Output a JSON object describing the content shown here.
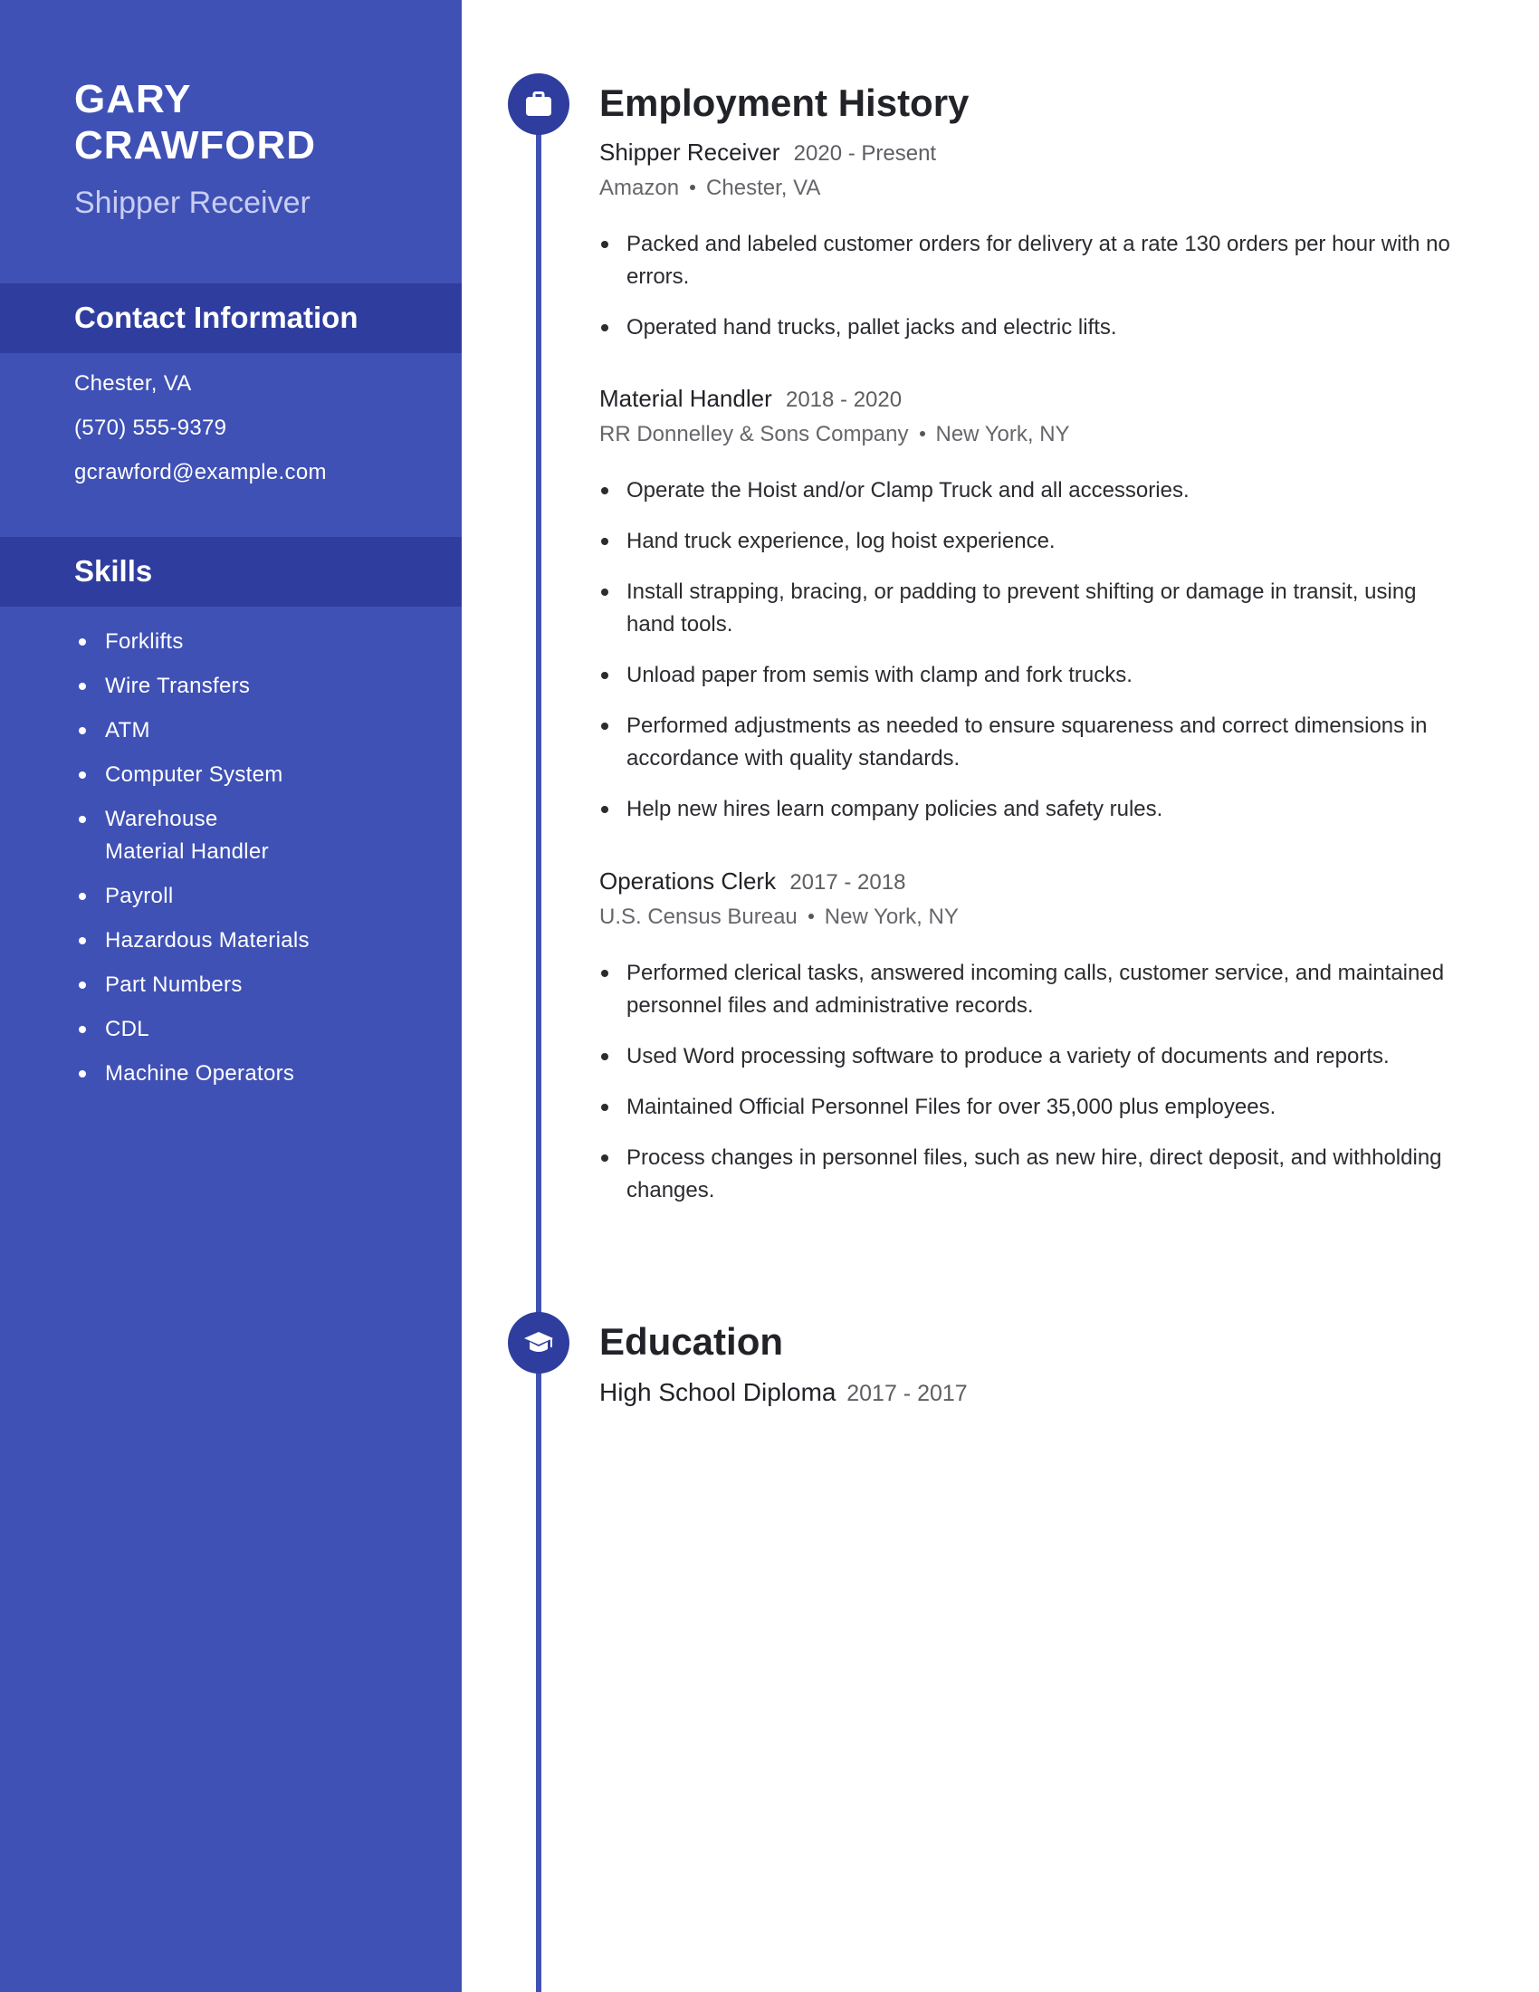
{
  "profile": {
    "first_name": "GARY",
    "last_name": "CRAWFORD",
    "title": "Shipper Receiver"
  },
  "contact": {
    "heading": "Contact Information",
    "location": "Chester, VA",
    "phone": "(570) 555-9379",
    "email": "gcrawford@example.com"
  },
  "skills": {
    "heading": "Skills",
    "items": [
      "Forklifts",
      "Wire Transfers",
      "ATM",
      "Computer System",
      "Warehouse Material Handler",
      "Payroll",
      "Hazardous Materials",
      "Part Numbers",
      "CDL",
      "Machine Operators"
    ]
  },
  "employment": {
    "heading": "Employment History",
    "icon": "briefcase-icon",
    "jobs": [
      {
        "title": "Shipper Receiver",
        "dates": "2020 - Present",
        "company": "Amazon",
        "location": "Chester, VA",
        "bullets": [
          "Packed and labeled customer orders for delivery at a rate 130 orders per hour with no errors.",
          "Operated hand trucks, pallet jacks and electric lifts."
        ]
      },
      {
        "title": "Material Handler",
        "dates": "2018 - 2020",
        "company": "RR Donnelley & Sons Company",
        "location": "New York, NY",
        "bullets": [
          "Operate the Hoist and/or Clamp Truck and all accessories.",
          "Hand truck experience, log hoist experience.",
          "Install strapping, bracing, or padding to prevent shifting or damage in transit, using hand tools.",
          "Unload paper from semis with clamp and fork trucks.",
          "Performed adjustments as needed to ensure squareness and correct dimensions in accordance with quality standards.",
          "Help new hires learn company policies and safety rules."
        ]
      },
      {
        "title": "Operations Clerk",
        "dates": "2017 - 2018",
        "company": "U.S. Census Bureau",
        "location": "New York, NY",
        "bullets": [
          "Performed clerical tasks, answered incoming calls, customer service, and maintained personnel files and administrative records.",
          "Used Word processing software to produce a variety of documents and reports.",
          "Maintained Official Personnel Files for over 35,000 plus employees.",
          "Process changes in personnel files, such as new hire, direct deposit, and withholding changes."
        ]
      }
    ]
  },
  "education": {
    "heading": "Education",
    "icon": "graduation-cap-icon",
    "entries": [
      {
        "degree": "High School Diploma",
        "dates": "2017 - 2017"
      }
    ]
  },
  "colors": {
    "sidebar": "#3f51b5",
    "sidebar_band": "#2f3d9e",
    "timeline": "#3f51b5",
    "icon_circle": "#2f3d9e",
    "subtitle": "#c8cdf2",
    "text": "#222328",
    "muted": "#5e5e63"
  }
}
